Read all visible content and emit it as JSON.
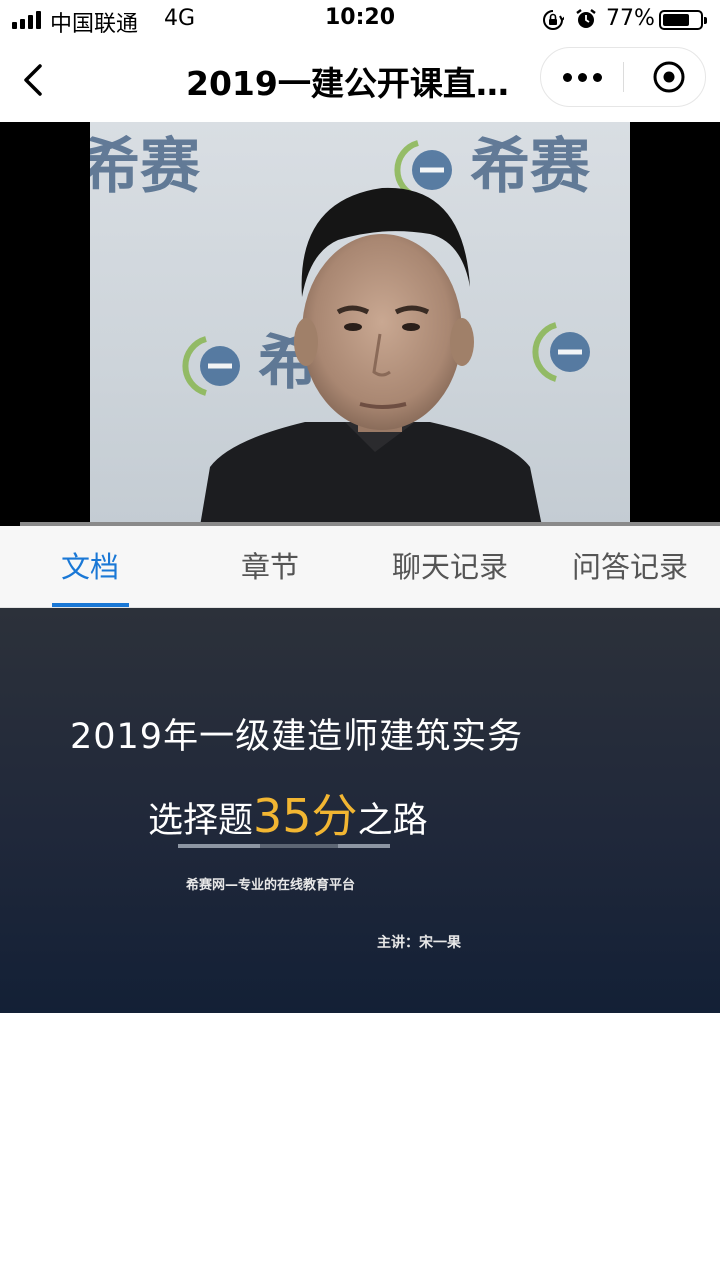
{
  "status_bar": {
    "carrier": "中国联通",
    "network": "4G",
    "time": "10:20",
    "battery": "77%",
    "battery_level": 0.77,
    "icons": [
      "signal-icon",
      "orientation-lock-icon",
      "alarm-icon",
      "battery-icon"
    ]
  },
  "nav": {
    "title": "2019一建公开课直…",
    "icons": [
      "back-icon",
      "more-icon",
      "close-icon"
    ]
  },
  "video": {
    "watermark": "希赛"
  },
  "tabs": [
    {
      "label": "文档",
      "active": true
    },
    {
      "label": "章节",
      "active": false
    },
    {
      "label": "聊天记录",
      "active": false
    },
    {
      "label": "问答记录",
      "active": false
    }
  ],
  "slide": {
    "title": "2019年一级建造师建筑实务",
    "subtitle_pre": "选择题",
    "subtitle_highlight": "35分",
    "subtitle_post": "之路",
    "platform": "希赛网—专业的在线教育平台",
    "lecturer": "主讲：宋一果"
  },
  "colors": {
    "accent": "#1a78d6",
    "highlight": "#f2b632"
  }
}
